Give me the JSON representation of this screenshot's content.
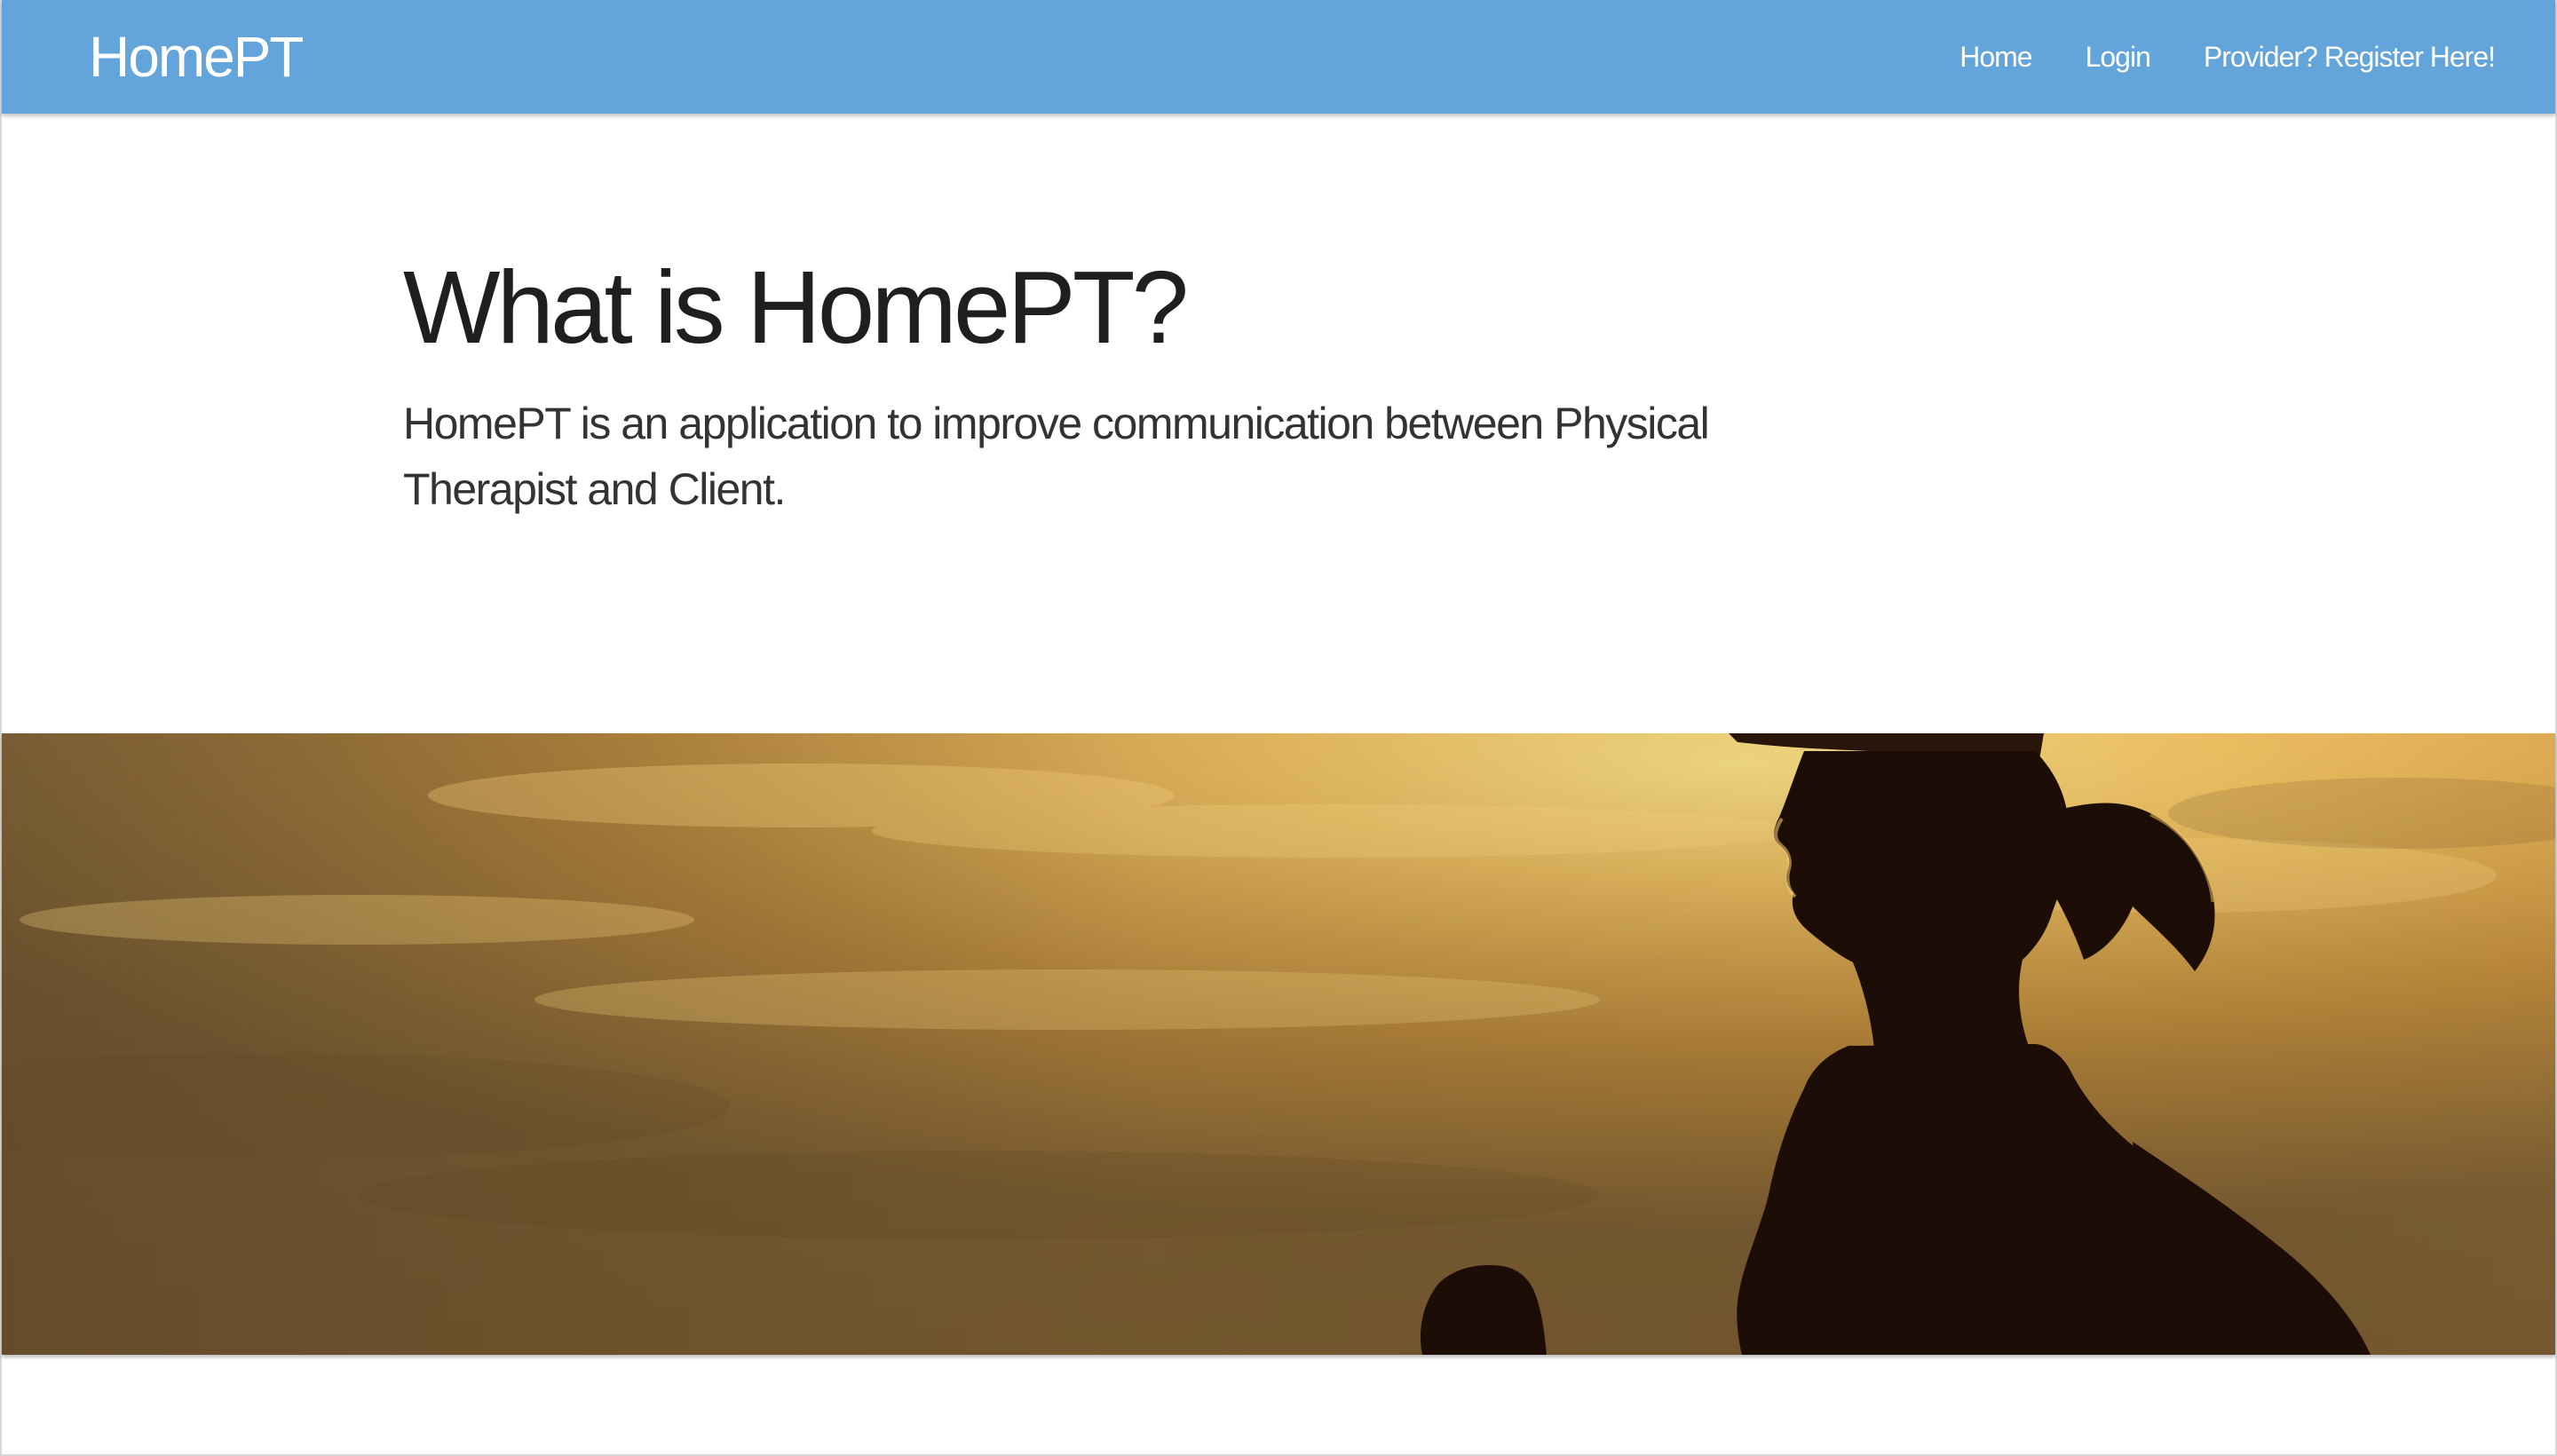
{
  "navbar": {
    "brand": "HomePT",
    "links": [
      {
        "label": "Home"
      },
      {
        "label": "Login"
      },
      {
        "label": "Provider? Register Here!"
      }
    ],
    "background_color": "#63a4da"
  },
  "intro": {
    "heading": "What is HomePT?",
    "description": "HomePT is an application to improve communication between Physical Therapist and Client."
  },
  "hero": {
    "image_subject": "silhouette of a woman running at sunset",
    "tone_colors": [
      "#f6c968",
      "#c9933f",
      "#7a5a30",
      "#1a0b05"
    ]
  }
}
